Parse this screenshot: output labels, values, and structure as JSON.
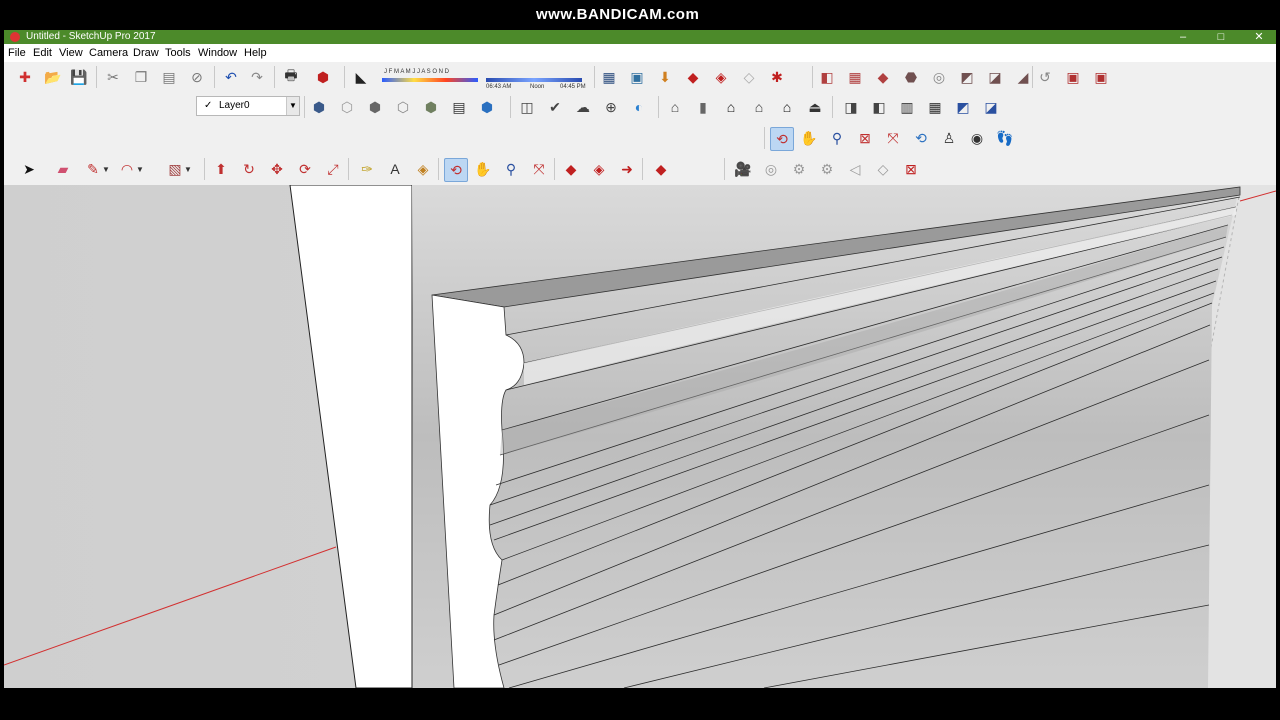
{
  "window": {
    "title": "Untitled - SketchUp Pro 2017",
    "minimize": "–",
    "maximize": "□",
    "close": "✕"
  },
  "watermark": "www.BANDICAM.com",
  "menu": [
    "File",
    "Edit",
    "View",
    "Camera",
    "Draw",
    "Tools",
    "Window",
    "Help"
  ],
  "layers": {
    "current": "Layer0"
  },
  "shadow_settings": {
    "months": "J F M A M J J A S O N D",
    "time_start": "06:43 AM",
    "time_noon": "Noon",
    "time_end": "04:45 PM"
  },
  "toolbars": {
    "standard": [
      {
        "name": "new-model-icon",
        "glyph": "✚",
        "color": "#d03030"
      },
      {
        "name": "open-icon",
        "glyph": "📂",
        "color": "#b07020"
      },
      {
        "name": "save-icon",
        "glyph": "💾",
        "color": "#2050a0"
      },
      {
        "name": "cut-icon",
        "glyph": "✂",
        "color": "#777777"
      },
      {
        "name": "copy-icon",
        "glyph": "❐",
        "color": "#777777"
      },
      {
        "name": "paste-icon",
        "glyph": "▤",
        "color": "#777777"
      },
      {
        "name": "erase-icon",
        "glyph": "⊘",
        "color": "#777777"
      },
      {
        "name": "undo-icon",
        "glyph": "↶",
        "color": "#2050b0"
      },
      {
        "name": "redo-icon",
        "glyph": "↷",
        "color": "#888888"
      },
      {
        "name": "print-icon",
        "glyph": "🖶",
        "color": "#333333"
      },
      {
        "name": "model-info-icon",
        "glyph": "⬢",
        "color": "#c02020"
      }
    ],
    "shadow_toggle": {
      "name": "shadows-toggle-icon",
      "glyph": "◣",
      "color": "#222222"
    },
    "warehouse": [
      {
        "name": "component-browser-icon",
        "glyph": "▦",
        "color": "#305080"
      },
      {
        "name": "match-photo-icon",
        "glyph": "▣",
        "color": "#3070a0"
      },
      {
        "name": "get-models-icon",
        "glyph": "⬇",
        "color": "#d08020"
      },
      {
        "name": "share-model-icon",
        "glyph": "◆",
        "color": "#c02020"
      },
      {
        "name": "share-component-icon",
        "glyph": "◈",
        "color": "#c02020"
      },
      {
        "name": "extension-warehouse-icon",
        "glyph": "◇",
        "color": "#aaaaaa"
      },
      {
        "name": "extension-manager-icon",
        "glyph": "✱",
        "color": "#c02020"
      }
    ],
    "sandbox": [
      {
        "name": "from-contours-icon",
        "glyph": "◧",
        "color": "#b04040"
      },
      {
        "name": "from-scratch-icon",
        "glyph": "▦",
        "color": "#b04040"
      },
      {
        "name": "smoove-icon",
        "glyph": "◆",
        "color": "#b04040"
      },
      {
        "name": "stamp-icon",
        "glyph": "⬣",
        "color": "#705050"
      },
      {
        "name": "drape-icon",
        "glyph": "◎",
        "color": "#888888"
      },
      {
        "name": "add-detail-icon",
        "glyph": "◩",
        "color": "#705050"
      },
      {
        "name": "flip-edge-icon",
        "glyph": "◪",
        "color": "#705050"
      },
      {
        "name": "terrain-edge-icon",
        "glyph": "◢",
        "color": "#705050"
      }
    ],
    "solid_tools": [
      {
        "name": "outer-shell-icon",
        "glyph": "↺",
        "color": "#888888"
      },
      {
        "name": "intersect-icon",
        "glyph": "▣",
        "color": "#b03030"
      },
      {
        "name": "union-icon",
        "glyph": "▣",
        "color": "#b03030"
      }
    ],
    "views": [
      {
        "name": "iso-view-icon",
        "glyph": "⬢",
        "color": "#3a5a8a"
      },
      {
        "name": "top-view-icon",
        "glyph": "⬡",
        "color": "#999999"
      },
      {
        "name": "front-view-icon",
        "glyph": "⬢",
        "color": "#666666"
      },
      {
        "name": "right-view-icon",
        "glyph": "⬡",
        "color": "#888888"
      },
      {
        "name": "back-view-icon",
        "glyph": "⬢",
        "color": "#708060"
      },
      {
        "name": "left-view-icon",
        "glyph": "▤",
        "color": "#333333"
      },
      {
        "name": "bottom-view-icon",
        "glyph": "⬢",
        "color": "#2a70c0"
      }
    ],
    "styles": [
      {
        "name": "xray-icon",
        "glyph": "◫",
        "color": "#444444"
      },
      {
        "name": "back-edges-icon",
        "glyph": "✔",
        "color": "#444444"
      },
      {
        "name": "wireframe-icon",
        "glyph": "☁",
        "color": "#444444"
      },
      {
        "name": "hidden-line-icon",
        "glyph": "⊕",
        "color": "#444444"
      },
      {
        "name": "shaded-icon",
        "glyph": "◐",
        "color": "#2a80d0"
      }
    ],
    "construction": [
      {
        "name": "house-front-icon",
        "glyph": "⌂",
        "color": "#444444"
      },
      {
        "name": "door-icon",
        "glyph": "▮",
        "color": "#666666"
      },
      {
        "name": "house-icon",
        "glyph": "⌂",
        "color": "#111111"
      },
      {
        "name": "house-open-icon",
        "glyph": "⌂",
        "color": "#333333"
      },
      {
        "name": "house-outline-icon",
        "glyph": "⌂",
        "color": "#111111"
      },
      {
        "name": "roof-icon",
        "glyph": "⏏",
        "color": "#333333"
      }
    ],
    "layers_extra": [
      {
        "name": "section-plane-icon",
        "glyph": "◨",
        "color": "#444444"
      },
      {
        "name": "section-display-icon",
        "glyph": "◧",
        "color": "#444444"
      },
      {
        "name": "section-cut-icon",
        "glyph": "▥",
        "color": "#333333"
      },
      {
        "name": "section-fill-icon",
        "glyph": "▦",
        "color": "#333333"
      },
      {
        "name": "section-color-icon",
        "glyph": "◩",
        "color": "#2a50a0"
      },
      {
        "name": "section-tools-icon",
        "glyph": "◪",
        "color": "#2a50a0"
      }
    ],
    "camera": [
      {
        "name": "orbit-icon",
        "glyph": "⟲",
        "color": "#c03030",
        "active": true
      },
      {
        "name": "pan-icon",
        "glyph": "✋",
        "color": "#c08030"
      },
      {
        "name": "zoom-icon",
        "glyph": "⚲",
        "color": "#2a50a0"
      },
      {
        "name": "zoom-window-icon",
        "glyph": "⊠",
        "color": "#c03030"
      },
      {
        "name": "zoom-extents-icon",
        "glyph": "⤧",
        "color": "#c03030"
      },
      {
        "name": "previous-view-icon",
        "glyph": "⟲",
        "color": "#2a70c0"
      },
      {
        "name": "position-camera-icon",
        "glyph": "♙",
        "color": "#333333"
      },
      {
        "name": "look-around-icon",
        "glyph": "◉",
        "color": "#333333"
      },
      {
        "name": "walk-icon",
        "glyph": "👣",
        "color": "#111111"
      }
    ],
    "drawing": [
      {
        "name": "select-icon",
        "glyph": "➤",
        "color": "#111111"
      },
      {
        "name": "eraser-icon",
        "glyph": "▰",
        "color": "#d05070"
      },
      {
        "name": "line-icon",
        "glyph": "✎",
        "color": "#c03030",
        "dropdown": true
      },
      {
        "name": "arc-icon",
        "glyph": "◠",
        "color": "#c03030",
        "dropdown": true
      },
      {
        "name": "rectangle-icon",
        "glyph": "▧",
        "color": "#a04040",
        "dropdown": true
      }
    ],
    "edit": [
      {
        "name": "push-pull-icon",
        "glyph": "⬆",
        "color": "#c03030"
      },
      {
        "name": "follow-me-icon",
        "glyph": "↻",
        "color": "#c03030"
      },
      {
        "name": "move-icon",
        "glyph": "✥",
        "color": "#c03030"
      },
      {
        "name": "rotate-icon",
        "glyph": "⟳",
        "color": "#c03030"
      },
      {
        "name": "scale-icon",
        "glyph": "⤢",
        "color": "#c03030"
      }
    ],
    "construction_tools": [
      {
        "name": "tape-measure-icon",
        "glyph": "✑",
        "color": "#c0a020"
      },
      {
        "name": "text-icon",
        "glyph": "A",
        "color": "#333333"
      },
      {
        "name": "paint-bucket-icon",
        "glyph": "◈",
        "color": "#c08020"
      }
    ],
    "camera2": [
      {
        "name": "orbit2-icon",
        "glyph": "⟲",
        "color": "#c03030",
        "active": true
      },
      {
        "name": "pan2-icon",
        "glyph": "✋",
        "color": "#c08030"
      },
      {
        "name": "zoom2-icon",
        "glyph": "⚲",
        "color": "#2a50a0"
      },
      {
        "name": "zoom-extents2-icon",
        "glyph": "⤧",
        "color": "#c03030"
      }
    ],
    "warehouse2": [
      {
        "name": "warehouse-icon",
        "glyph": "◆",
        "color": "#c02020"
      },
      {
        "name": "share2-icon",
        "glyph": "◈",
        "color": "#c02020"
      },
      {
        "name": "send-to-layout-icon",
        "glyph": "➜",
        "color": "#c02020"
      }
    ],
    "ruby": {
      "name": "ruby-console-icon",
      "glyph": "◆",
      "color": "#c02020"
    },
    "animation": [
      {
        "name": "scene-camera-icon",
        "glyph": "🎥",
        "color": "#333333"
      },
      {
        "name": "scene-play-icon",
        "glyph": "◎",
        "color": "#999999"
      },
      {
        "name": "scene-add-icon",
        "glyph": "⚙",
        "color": "#999999"
      },
      {
        "name": "scene-remove-icon",
        "glyph": "⚙",
        "color": "#999999"
      },
      {
        "name": "scene-update-icon",
        "glyph": "◁",
        "color": "#999999"
      },
      {
        "name": "scene-fly-icon",
        "glyph": "◇",
        "color": "#999999"
      },
      {
        "name": "scene-delete-icon",
        "glyph": "⊠",
        "color": "#c02020"
      }
    ]
  },
  "colors": {
    "title_bar": "#4c8a2a",
    "viewport_bg": "#d8d8d8",
    "red_axis": "#d23030"
  }
}
